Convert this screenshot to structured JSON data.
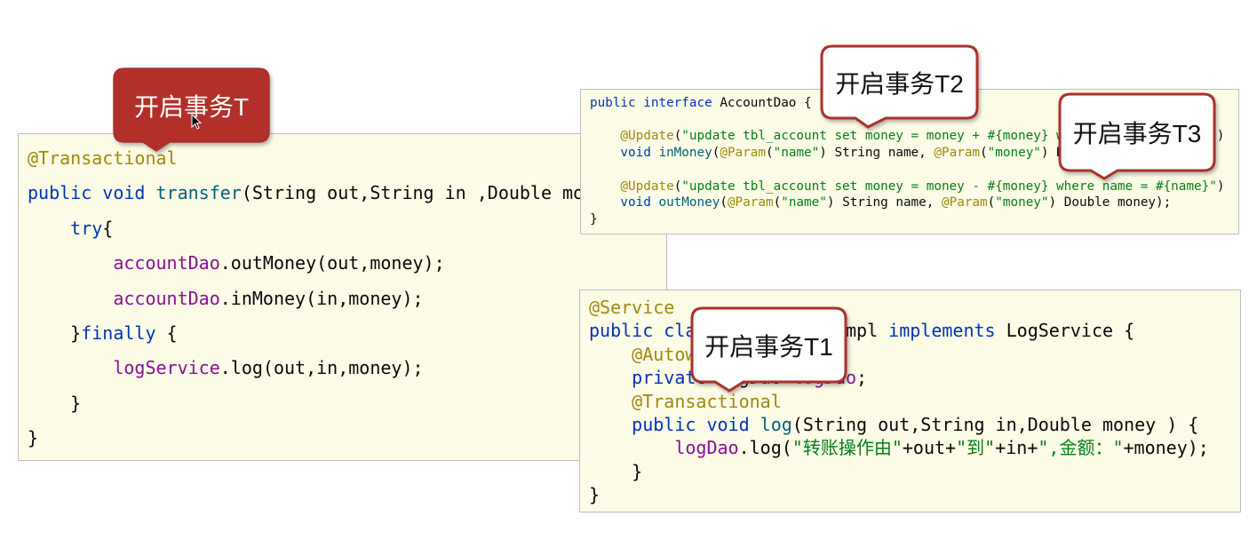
{
  "colors": {
    "annotation": "#9E880D",
    "keyword": "#0033B3",
    "method": "#00627A",
    "field": "#871094",
    "string": "#067D17",
    "plain": "#080808",
    "panel_background": "#FCFCE7",
    "panel_border": "#BDBDBD",
    "callout_fill": "#B3302A",
    "callout_border": "#A8322D"
  },
  "cursor_icon": "arrow-pointer",
  "callouts": {
    "t": {
      "label": "开启事务T"
    },
    "t2": {
      "label": "开启事务T2"
    },
    "t3": {
      "label": "开启事务T3"
    },
    "t1": {
      "label": "开启事务T1"
    }
  },
  "transfer_panel": {
    "lines": [
      {
        "tokens": [
          {
            "text": "@Transactional",
            "kind": "annotation"
          }
        ]
      },
      {
        "tokens": [
          {
            "text": "public void ",
            "kind": "keyword"
          },
          {
            "text": "transfer",
            "kind": "method"
          },
          {
            "text": "(String out,String in ,Double mo",
            "kind": "plain"
          }
        ]
      },
      {
        "tokens": [
          {
            "text": "    try",
            "kind": "keyword"
          },
          {
            "text": "{",
            "kind": "plain"
          }
        ]
      },
      {
        "tokens": [
          {
            "text": "        accountDao",
            "kind": "field"
          },
          {
            "text": ".outMoney(out,money);",
            "kind": "plain"
          }
        ]
      },
      {
        "tokens": [
          {
            "text": "        accountDao",
            "kind": "field"
          },
          {
            "text": ".inMoney(in,money);",
            "kind": "plain"
          }
        ]
      },
      {
        "tokens": [
          {
            "text": "    }",
            "kind": "plain"
          },
          {
            "text": "finally",
            "kind": "keyword"
          },
          {
            "text": " {",
            "kind": "plain"
          }
        ]
      },
      {
        "tokens": [
          {
            "text": "        logService",
            "kind": "field"
          },
          {
            "text": ".log(out,in,money);",
            "kind": "plain"
          }
        ]
      },
      {
        "tokens": [
          {
            "text": "    }",
            "kind": "plain"
          }
        ]
      },
      {
        "tokens": [
          {
            "text": "}",
            "kind": "plain"
          }
        ]
      }
    ]
  },
  "account_dao_panel": {
    "lines": [
      {
        "tokens": [
          {
            "text": "public interface ",
            "kind": "keyword"
          },
          {
            "text": "AccountDao {",
            "kind": "plain"
          }
        ]
      },
      {
        "tokens": []
      },
      {
        "tokens": [
          {
            "text": "    @Update",
            "kind": "annotation"
          },
          {
            "text": "(",
            "kind": "plain"
          },
          {
            "text": "\"update tbl_account set money = money + #{money} w",
            "kind": "string"
          }
        ],
        "after_callout": [
          {
            "text": ")",
            "kind": "plain"
          }
        ]
      },
      {
        "tokens": [
          {
            "text": "    void ",
            "kind": "keyword"
          },
          {
            "text": "inMoney",
            "kind": "method"
          },
          {
            "text": "(",
            "kind": "plain"
          },
          {
            "text": "@Param",
            "kind": "annotation"
          },
          {
            "text": "(",
            "kind": "plain"
          },
          {
            "text": "\"name\"",
            "kind": "string"
          },
          {
            "text": ") String name, ",
            "kind": "plain"
          },
          {
            "text": "@Param",
            "kind": "annotation"
          },
          {
            "text": "(",
            "kind": "plain"
          },
          {
            "text": "\"money\"",
            "kind": "string"
          },
          {
            "text": ") D",
            "kind": "plain"
          }
        ]
      },
      {
        "tokens": []
      },
      {
        "tokens": [
          {
            "text": "    @Update",
            "kind": "annotation"
          },
          {
            "text": "(",
            "kind": "plain"
          },
          {
            "text": "\"update tbl_account set money = money - #{money} where name = #{name}\"",
            "kind": "string"
          },
          {
            "text": ")",
            "kind": "plain"
          }
        ]
      },
      {
        "tokens": [
          {
            "text": "    void ",
            "kind": "keyword"
          },
          {
            "text": "outMoney",
            "kind": "method"
          },
          {
            "text": "(",
            "kind": "plain"
          },
          {
            "text": "@Param",
            "kind": "annotation"
          },
          {
            "text": "(",
            "kind": "plain"
          },
          {
            "text": "\"name\"",
            "kind": "string"
          },
          {
            "text": ") String name, ",
            "kind": "plain"
          },
          {
            "text": "@Param",
            "kind": "annotation"
          },
          {
            "text": "(",
            "kind": "plain"
          },
          {
            "text": "\"money\"",
            "kind": "string"
          },
          {
            "text": ") Double money);",
            "kind": "plain"
          }
        ]
      },
      {
        "tokens": [
          {
            "text": "}",
            "kind": "plain"
          }
        ]
      }
    ]
  },
  "log_service_panel": {
    "lines": [
      {
        "tokens": [
          {
            "text": "@Service",
            "kind": "annotation"
          }
        ]
      },
      {
        "tokens": [
          {
            "text": "public cla",
            "kind": "keyword"
          }
        ],
        "after_callout": [
          {
            "text": "mpl ",
            "kind": "plain"
          },
          {
            "text": "implements",
            "kind": "keyword"
          },
          {
            "text": " LogService {",
            "kind": "plain"
          }
        ]
      },
      {
        "tokens": [
          {
            "text": "    @Autow",
            "kind": "annotation"
          }
        ]
      },
      {
        "tokens": [
          {
            "text": "    private",
            "kind": "keyword"
          },
          {
            "text": " LogDao ",
            "kind": "plain"
          },
          {
            "text": "logDao",
            "kind": "field"
          },
          {
            "text": ";",
            "kind": "plain"
          }
        ]
      },
      {
        "tokens": [
          {
            "text": "    @Transactional",
            "kind": "annotation"
          }
        ]
      },
      {
        "tokens": [
          {
            "text": "    public void ",
            "kind": "keyword"
          },
          {
            "text": "log",
            "kind": "method"
          },
          {
            "text": "(String out,String in,Double money ) {",
            "kind": "plain"
          }
        ]
      },
      {
        "tokens": [
          {
            "text": "        logDao",
            "kind": "field"
          },
          {
            "text": ".log(",
            "kind": "plain"
          },
          {
            "text": "\"转账操作由\"",
            "kind": "string"
          },
          {
            "text": "+out+",
            "kind": "plain"
          },
          {
            "text": "\"到\"",
            "kind": "string"
          },
          {
            "text": "+in+",
            "kind": "plain"
          },
          {
            "text": "\",金额：\"",
            "kind": "string"
          },
          {
            "text": "+money);",
            "kind": "plain"
          }
        ]
      },
      {
        "tokens": [
          {
            "text": "    }",
            "kind": "plain"
          }
        ]
      },
      {
        "tokens": [
          {
            "text": "}",
            "kind": "plain"
          }
        ]
      }
    ]
  }
}
